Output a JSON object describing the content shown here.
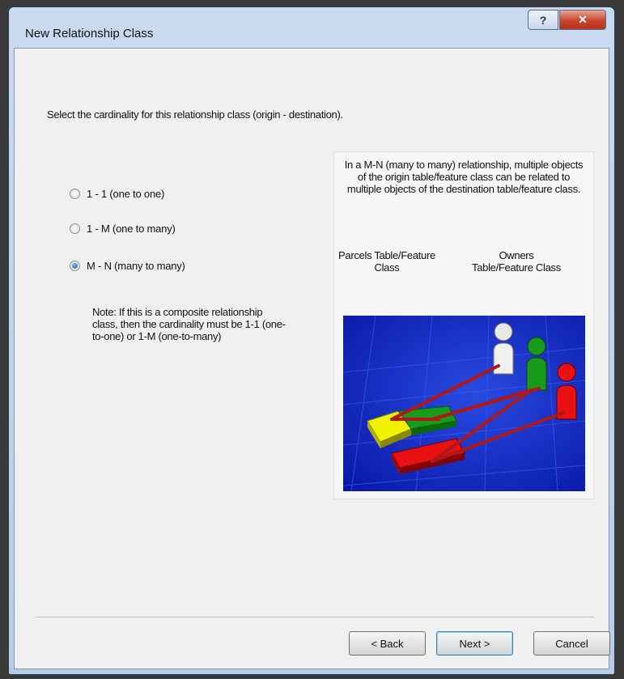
{
  "window": {
    "title": "New Relationship Class",
    "help_glyph": "?",
    "close_glyph": "✕"
  },
  "instruction": "Select the cardinality for this relationship class (origin - destination).",
  "options": [
    {
      "label": "1 - 1 (one to one)",
      "selected": false
    },
    {
      "label": "1 - M (one to many)",
      "selected": false
    },
    {
      "label": "M - N (many to many)",
      "selected": true
    }
  ],
  "note": "Note: If this is a composite relationship class, then the cardinality must be 1-1 (one-to-one) or 1-M (one-to-many)",
  "info": {
    "description": "In a M-N (many to many) relationship, multiple objects of the origin table/feature class can be related to multiple objects of the destination table/feature class.",
    "origin_label": "Parcels Table/Feature Class",
    "destination_label": "Owners Table/Feature Class"
  },
  "illustration": {
    "parcel_colors": [
      "#f2f200",
      "#1a9a1a",
      "#e81010"
    ],
    "owner_colors": [
      "#ffffff",
      "#1a9a1a",
      "#e81010"
    ],
    "background": "#0a24c8",
    "link_color": "#b01818"
  },
  "buttons": {
    "back": "< Back",
    "next": "Next >",
    "cancel": "Cancel"
  }
}
